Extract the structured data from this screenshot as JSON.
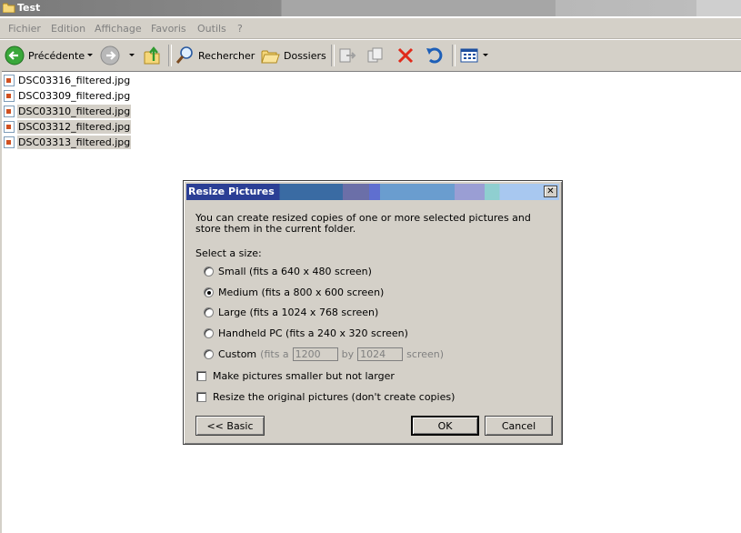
{
  "window": {
    "title": "Test"
  },
  "menu": [
    "Fichier",
    "Edition",
    "Affichage",
    "Favoris",
    "Outils",
    "?"
  ],
  "toolbar": {
    "back_label": "Précédente",
    "search_label": "Rechercher",
    "folders_label": "Dossiers"
  },
  "files": [
    {
      "name": "DSC03316_filtered.jpg",
      "selected": false
    },
    {
      "name": "DSC03309_filtered.jpg",
      "selected": false
    },
    {
      "name": "DSC03310_filtered.jpg",
      "selected": true
    },
    {
      "name": "DSC03312_filtered.jpg",
      "selected": true
    },
    {
      "name": "DSC03313_filtered.jpg",
      "selected": true
    }
  ],
  "dialog": {
    "title": "Resize Pictures",
    "close": "✕",
    "description": "You can create resized copies of one or more selected pictures and store them in the current folder.",
    "size_label": "Select a size:",
    "options": [
      {
        "label": "Small (fits a 640 x 480 screen)",
        "checked": false
      },
      {
        "label": "Medium (fits a 800 x 600 screen)",
        "checked": true
      },
      {
        "label": "Large (fits a 1024 x 768 screen)",
        "checked": false
      },
      {
        "label": "Handheld PC (fits a 240 x 320 screen)",
        "checked": false
      }
    ],
    "custom": {
      "label": "Custom",
      "fits_a": "(fits a",
      "width": "1200",
      "by": "by",
      "height": "1024",
      "screen": "screen)"
    },
    "checkboxes": [
      {
        "label": "Make pictures smaller but not larger",
        "checked": false
      },
      {
        "label": "Resize the original pictures (don't create copies)",
        "checked": false
      }
    ],
    "basic_button": "<< Basic",
    "ok_button": "OK",
    "cancel_button": "Cancel"
  },
  "colors": {
    "selection": "#d4d0c8",
    "dialog_bg": "#d4d0c8",
    "title_start": "#2b3f95"
  }
}
